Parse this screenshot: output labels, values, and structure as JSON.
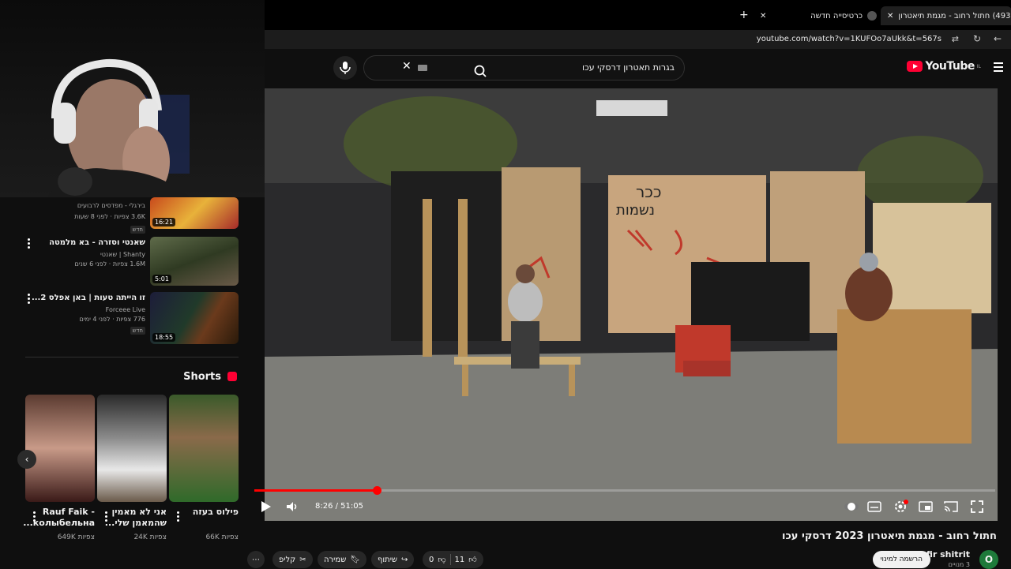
{
  "browser": {
    "tabs": [
      {
        "label": "(493) חתול רחוב - מגמת תיאטרון",
        "active": true
      },
      {
        "label": "כרטיסייה חדשה",
        "active": false
      }
    ],
    "new_tab": "+",
    "url": "youtube.com/watch?v=1KUFOo7aUkk&t=567s"
  },
  "header": {
    "logo_text": "YouTube",
    "region": "IL",
    "search_query": "בגרות תאטרון דרסקי עכו"
  },
  "related": [
    {
      "title": "",
      "channel": "בירגלי - מפדסים לרבועים",
      "meta": "3.6K צפיות · לפני 8 שעות",
      "badge": "חדש",
      "duration": "16:21"
    },
    {
      "title": "שאנטי וסזרה - בא מלמטה",
      "channel": "שאנטי | Shanty",
      "meta": "1.6M צפיות · לפני 6 שנים",
      "badge": "",
      "duration": "5:01"
    },
    {
      "title": "זו הייתה טעות | באן אפלס 2...",
      "channel": "Forceee Live",
      "meta": "776 צפיות · לפני 4 ימים",
      "badge": "חדש",
      "duration": "18:55"
    }
  ],
  "shorts": {
    "heading": "Shorts",
    "items": [
      {
        "title": "Rauf Faik - колыбельна...",
        "views": "649K צפיות"
      },
      {
        "title": "אני לא מאמין שהמאמן שלי...",
        "views": "24K צפיות"
      },
      {
        "title": "פילוס בעזה",
        "views": "66K צפיות"
      }
    ]
  },
  "player": {
    "current_time": "8:26",
    "duration": "51:05",
    "time_display": "8:26 / 51:05",
    "progress": 0.165
  },
  "video": {
    "title": "חתול רחוב - מגמת תיאטרון 2023 דרסקי עכו",
    "channel": "ofir shitrit",
    "channel_initial": "O",
    "subscribers": "3 מנויים",
    "subscribe_label": "הרשמה למינוי",
    "likes": "11",
    "dislikes": "0",
    "share_label": "שיתוף",
    "save_label": "שמירה",
    "clip_label": "קליפ"
  },
  "colors": {
    "accent": "#ff0000",
    "brand": "#ff0033",
    "background": "#0f0f0f"
  }
}
